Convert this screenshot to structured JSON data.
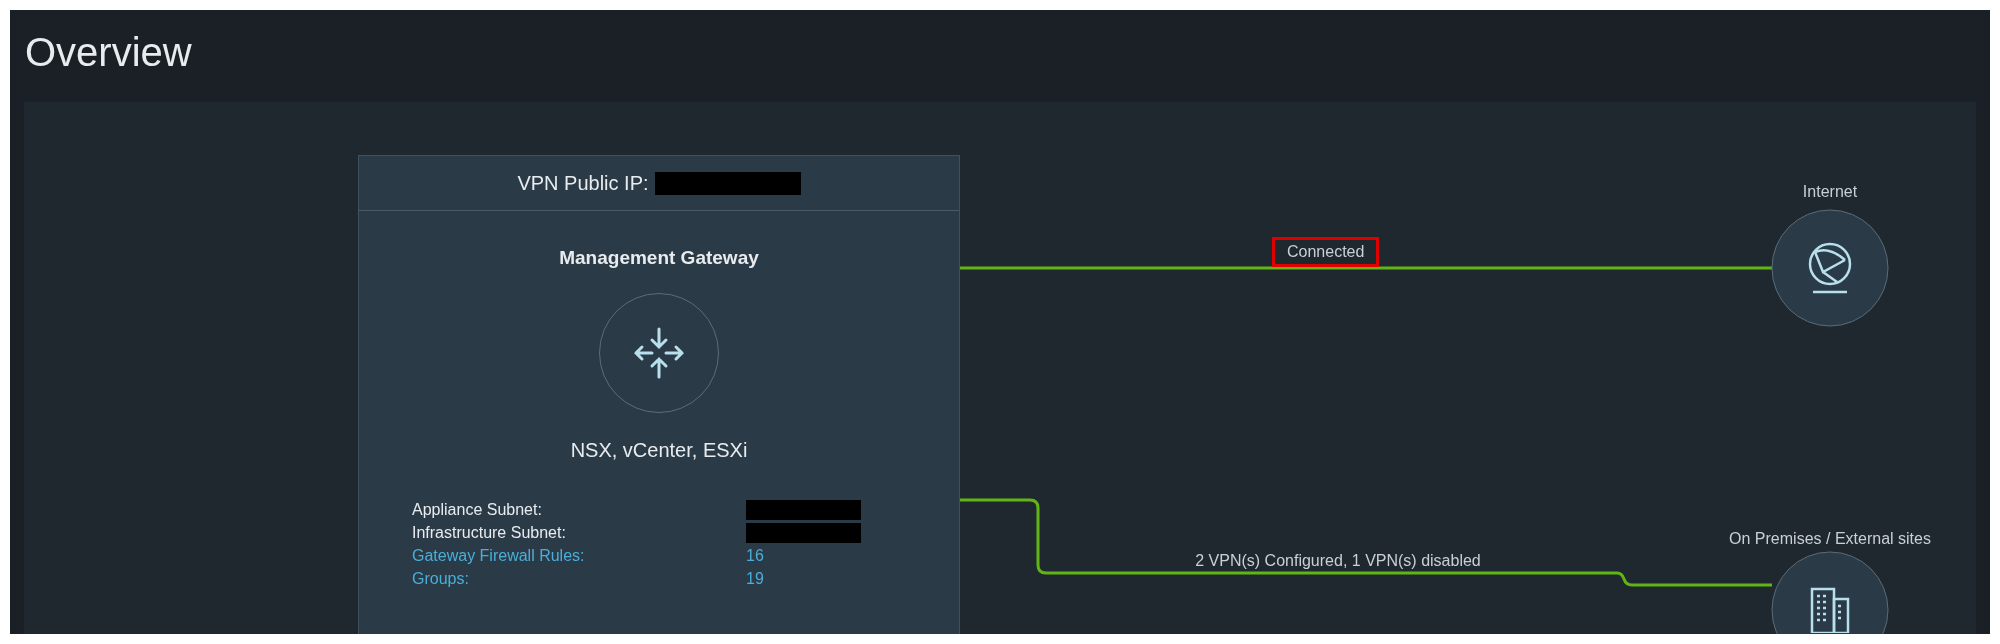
{
  "page": {
    "title": "Overview"
  },
  "gateway": {
    "header_label": "VPN Public IP:",
    "title": "Management Gateway",
    "services": "NSX, vCenter, ESXi",
    "details": [
      {
        "label": "Appliance Subnet:",
        "kind": "redacted"
      },
      {
        "label": "Infrastructure Subnet:",
        "kind": "redacted"
      },
      {
        "label": "Gateway Firewall Rules:",
        "value": "16",
        "kind": "link"
      },
      {
        "label": "Groups:",
        "value": "19",
        "kind": "link"
      }
    ]
  },
  "connections": [
    {
      "label": "Connected",
      "highlighted": true
    },
    {
      "label": "2 VPN(s) Configured, 1 VPN(s) disabled",
      "highlighted": false
    }
  ],
  "endpoints": [
    {
      "label": "Internet",
      "kind": "globe"
    },
    {
      "label": "On Premises / External sites",
      "kind": "building"
    }
  ]
}
